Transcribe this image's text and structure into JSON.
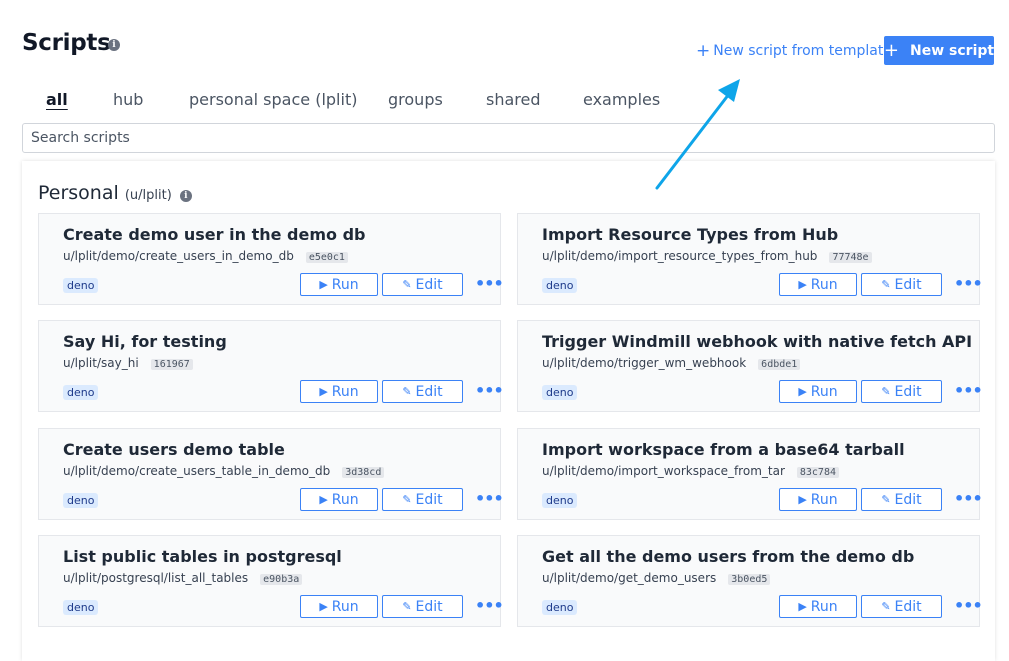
{
  "page": {
    "title": "Scripts",
    "info_glyph": "i"
  },
  "header": {
    "template_button_icon": "plus-icon",
    "template_button_label": "New script from template",
    "new_button_icon": "plus-icon",
    "new_button_label": "New script"
  },
  "tabs": [
    {
      "label": "all",
      "active": true
    },
    {
      "label": "hub",
      "active": false
    },
    {
      "label": "personal space (lplit)",
      "active": false
    },
    {
      "label": "groups",
      "active": false
    },
    {
      "label": "shared",
      "active": false
    },
    {
      "label": "examples",
      "active": false
    }
  ],
  "search": {
    "placeholder": "Search scripts",
    "value": ""
  },
  "section": {
    "title": "Personal",
    "owner": "(u/lplit)"
  },
  "buttons": {
    "run": "Run",
    "edit": "Edit",
    "more": "•••"
  },
  "scripts": [
    {
      "title": "Create demo user in the demo db",
      "path": "u/lplit/demo/create_users_in_demo_db",
      "hash": "e5e0c1",
      "lang": "deno"
    },
    {
      "title": "Import Resource Types from Hub",
      "path": "u/lplit/demo/import_resource_types_from_hub",
      "hash": "77748e",
      "lang": "deno"
    },
    {
      "title": "Say Hi, for testing",
      "path": "u/lplit/say_hi",
      "hash": "161967",
      "lang": "deno"
    },
    {
      "title": "Trigger Windmill webhook with native fetch API",
      "path": "u/lplit/demo/trigger_wm_webhook",
      "hash": "6dbde1",
      "lang": "deno"
    },
    {
      "title": "Create users demo table",
      "path": "u/lplit/demo/create_users_table_in_demo_db",
      "hash": "3d38cd",
      "lang": "deno"
    },
    {
      "title": "Import workspace from a base64 tarball",
      "path": "u/lplit/demo/import_workspace_from_tar",
      "hash": "83c784",
      "lang": "deno"
    },
    {
      "title": "List public tables in postgresql",
      "path": "u/lplit/postgresql/list_all_tables",
      "hash": "e90b3a",
      "lang": "deno"
    },
    {
      "title": "Get all the demo users from the demo db",
      "path": "u/lplit/demo/get_demo_users",
      "hash": "3b0ed5",
      "lang": "deno"
    }
  ],
  "colors": {
    "accent": "#3b82f6",
    "annotation_arrow": "#0ea5e9"
  }
}
